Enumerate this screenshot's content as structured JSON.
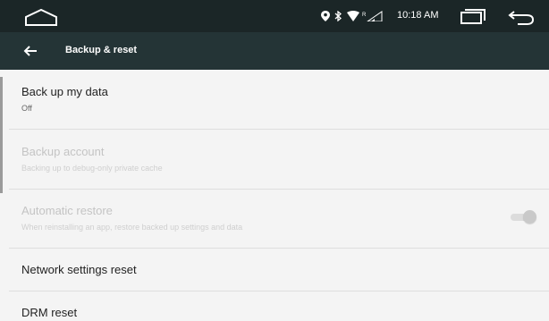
{
  "status_bar": {
    "time": "10:18 AM",
    "icons": [
      "home-icon",
      "location-icon",
      "bluetooth-icon",
      "wifi-icon",
      "cellular-signal-icon",
      "recents-icon",
      "back-icon"
    ]
  },
  "toolbar": {
    "back_icon": "arrow-back-icon",
    "title": "Backup & reset"
  },
  "settings": [
    {
      "title": "Back up my data",
      "subtitle": "Off",
      "enabled": true
    },
    {
      "title": "Backup account",
      "subtitle": "Backing up to debug-only private cache",
      "enabled": false
    },
    {
      "title": "Automatic restore",
      "subtitle": "When reinstalling an app, restore backed up settings and data",
      "enabled": false,
      "toggle": "on"
    },
    {
      "title": "Network settings reset",
      "enabled": true
    },
    {
      "title": "DRM reset",
      "enabled": true
    }
  ],
  "colors": {
    "status_bar_bg": "#1b2627",
    "toolbar_bg": "#243436",
    "list_bg": "#f4f4f4",
    "text_primary": "#222222",
    "text_disabled": "#c4c4c4"
  }
}
